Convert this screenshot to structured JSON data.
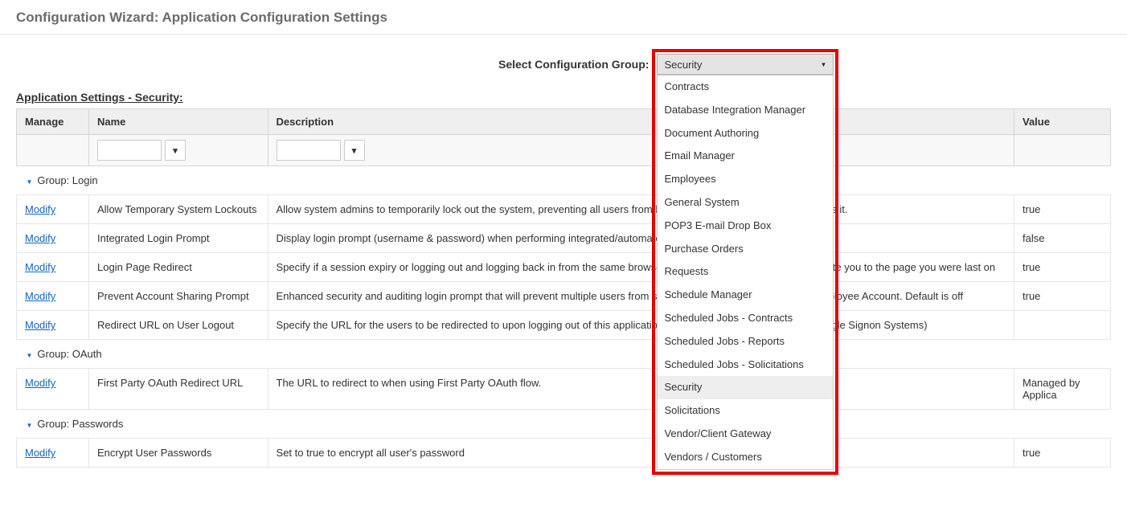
{
  "page_title": "Configuration Wizard: Application Configuration Settings",
  "select_label": "Select Configuration Group:",
  "select_value": "Security",
  "dropdown_items": [
    "Contracts",
    "Database Integration Manager",
    "Document Authoring",
    "Email Manager",
    "Employees",
    "General System",
    "POP3 E-mail Drop Box",
    "Purchase Orders",
    "Requests",
    "Schedule Manager",
    "Scheduled Jobs - Contracts",
    "Scheduled Jobs - Reports",
    "Scheduled Jobs - Solicitations",
    "Security",
    "Solicitations",
    "Vendor/Client Gateway",
    "Vendors / Customers"
  ],
  "dropdown_selected_index": 13,
  "section_title": "Application Settings - Security:",
  "columns": {
    "manage": "Manage",
    "name": "Name",
    "description": "Description",
    "value": "Value"
  },
  "filter_placeholder": "",
  "funnel_glyph": "▼",
  "modify_label": "Modify",
  "groups": [
    {
      "name": "Group: Login",
      "rows": [
        {
          "name": "Allow Temporary System Lockouts",
          "desc": "Allow system admins to temporarily lock out the system, preventing all users from logging in until a system admin unlocks it.",
          "value": "true"
        },
        {
          "name": "Integrated Login Prompt",
          "desc": "Display login prompt (username & password) when performing integrated/automated login attempts",
          "value": "false"
        },
        {
          "name": "Login Page Redirect",
          "desc": "Specify if a session expiry or logging out and logging back in from the same browser will cause the re-login link to navigate you to the page you were last on",
          "value": "true"
        },
        {
          "name": "Prevent Account Sharing Prompt",
          "desc": "Enhanced security and auditing login prompt that will prevent multiple users from simultanious logins from the same Employee Account. Default is off",
          "value": "true"
        },
        {
          "name": "Redirect URL on User Logout",
          "desc": "Specify the URL for the users to be redirected to upon logging out of this application. (Note: This is normally used for Single Signon Systems)",
          "value": ""
        }
      ]
    },
    {
      "name": "Group: OAuth",
      "rows": [
        {
          "name": "First Party OAuth Redirect URL",
          "desc": "The URL to redirect to when using First Party OAuth flow.",
          "value": "Managed by Applica"
        }
      ]
    },
    {
      "name": "Group: Passwords",
      "rows": [
        {
          "name": "Encrypt User Passwords",
          "desc": "Set to true to encrypt all user's password",
          "value": "true"
        }
      ]
    }
  ]
}
